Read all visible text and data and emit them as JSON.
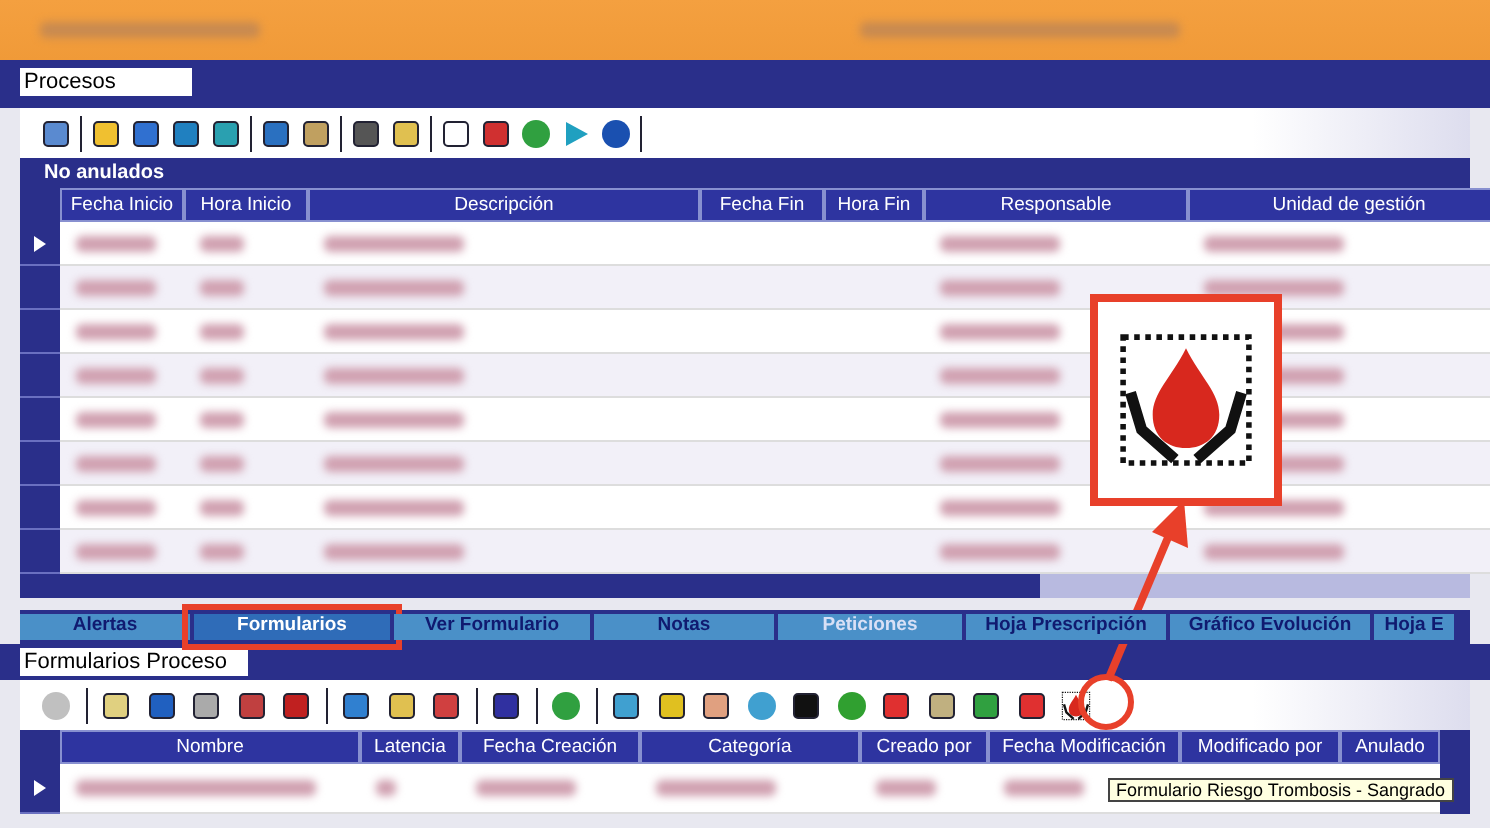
{
  "processes_panel": {
    "title": "Procesos",
    "group_label": "No anulados",
    "columns": [
      "Fecha Inicio",
      "Hora Inicio",
      "Descripción",
      "Fecha Fin",
      "Hora Fin",
      "Responsable",
      "Unidad de gestión"
    ]
  },
  "tabs": [
    {
      "label": "Alertas",
      "selected": false,
      "disabled": false
    },
    {
      "label": "Formularios",
      "selected": true,
      "disabled": false,
      "highlighted": true
    },
    {
      "label": "Ver Formulario",
      "selected": false,
      "disabled": false
    },
    {
      "label": "Notas",
      "selected": false,
      "disabled": false
    },
    {
      "label": "Peticiones",
      "selected": false,
      "disabled": true
    },
    {
      "label": "Hoja Prescripción",
      "selected": false,
      "disabled": false
    },
    {
      "label": "Gráfico Evolución",
      "selected": false,
      "disabled": false
    },
    {
      "label": "Hoja E",
      "selected": false,
      "disabled": false
    }
  ],
  "forms_panel": {
    "title": "Formularios Proceso",
    "columns": [
      "Nombre",
      "Latencia",
      "Fecha Creación",
      "Categoría",
      "Creado por",
      "Fecha Modificación",
      "Modificado por",
      "Anulado"
    ],
    "tooltip": "Formulario Riesgo Trombosis - Sangrado"
  }
}
